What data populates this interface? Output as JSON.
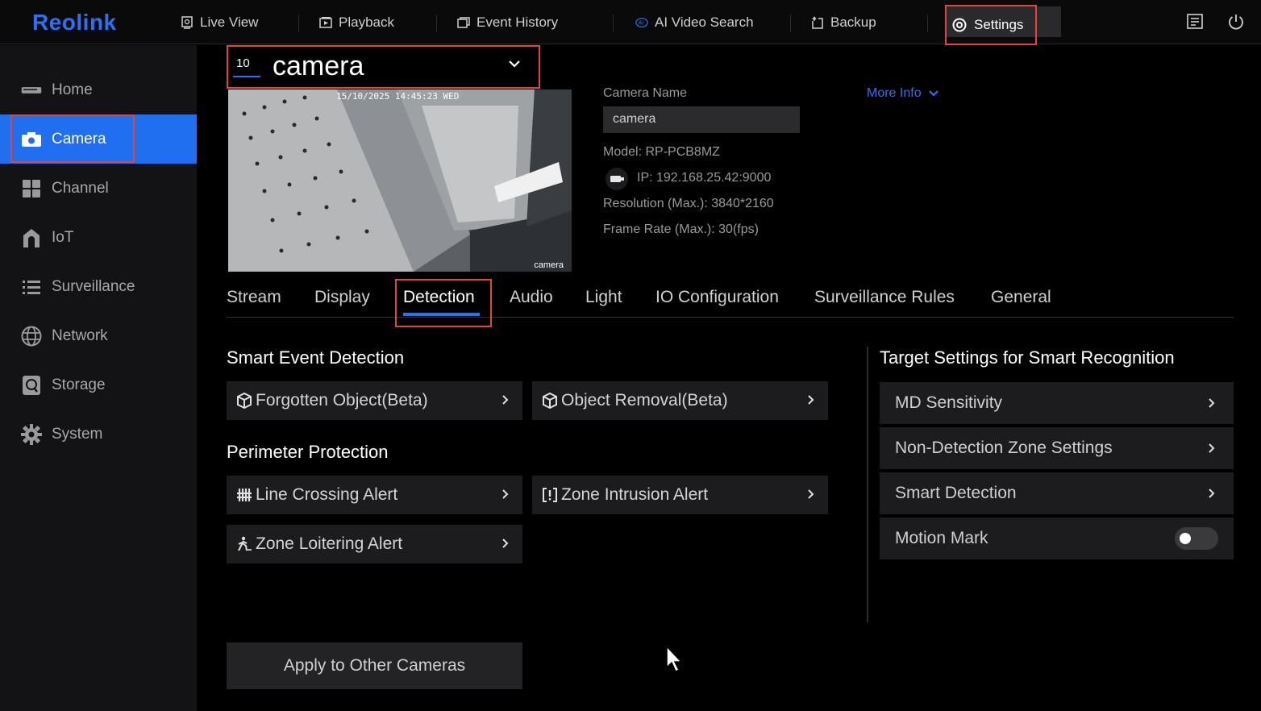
{
  "app": {
    "logo": "Reolink"
  },
  "topnav": {
    "items": [
      {
        "label": "Live View",
        "icon": "live-view-icon"
      },
      {
        "label": "Playback",
        "icon": "playback-icon"
      },
      {
        "label": "Event History",
        "icon": "event-history-icon"
      },
      {
        "label": "AI Video Search",
        "icon": "ai-search-icon"
      },
      {
        "label": "Backup",
        "icon": "backup-icon"
      },
      {
        "label": "Settings",
        "icon": "gear-icon",
        "selected": true
      }
    ]
  },
  "sidebar": {
    "items": [
      {
        "label": "Home",
        "icon": "home-icon"
      },
      {
        "label": "Camera",
        "icon": "camera-icon",
        "active": true
      },
      {
        "label": "Channel",
        "icon": "channel-icon"
      },
      {
        "label": "IoT",
        "icon": "iot-icon"
      },
      {
        "label": "Surveillance",
        "icon": "list-icon"
      },
      {
        "label": "Network",
        "icon": "globe-icon"
      },
      {
        "label": "Storage",
        "icon": "storage-icon"
      },
      {
        "label": "System",
        "icon": "gear-icon"
      }
    ]
  },
  "camera_select": {
    "number": "10",
    "name": "camera"
  },
  "preview": {
    "timestamp": "15/10/2025 14:45:23 WED",
    "label": "camera"
  },
  "info": {
    "name_label": "Camera Name",
    "name_value": "camera",
    "more_info": "More Info",
    "model": "Model:  RP-PCB8MZ",
    "ip": "IP:   192.168.25.42:9000",
    "resolution": "Resolution (Max.):   3840*2160",
    "frame_rate": "Frame Rate (Max.):   30(fps)"
  },
  "tabs": [
    "Stream",
    "Display",
    "Detection",
    "Audio",
    "Light",
    "IO Configuration",
    "Surveillance Rules",
    "General"
  ],
  "active_tab": "Detection",
  "smart_event": {
    "title": "Smart Event Detection",
    "items": [
      "Forgotten Object(Beta)",
      "Object Removal(Beta)"
    ]
  },
  "perimeter": {
    "title": "Perimeter Protection",
    "items": [
      "Line Crossing Alert",
      "Zone Intrusion Alert",
      "Zone Loitering Alert"
    ]
  },
  "target": {
    "title": "Target Settings for Smart Recognition",
    "items": [
      "MD Sensitivity",
      "Non-Detection Zone Settings",
      "Smart Detection"
    ],
    "motion_mark": {
      "label": "Motion Mark",
      "enabled": false
    }
  },
  "apply_button": "Apply to Other Cameras",
  "colors": {
    "accent": "#1f6ff0",
    "highlight": "#e0473c",
    "bg": "#000000",
    "panel": "#1c1c1e"
  }
}
